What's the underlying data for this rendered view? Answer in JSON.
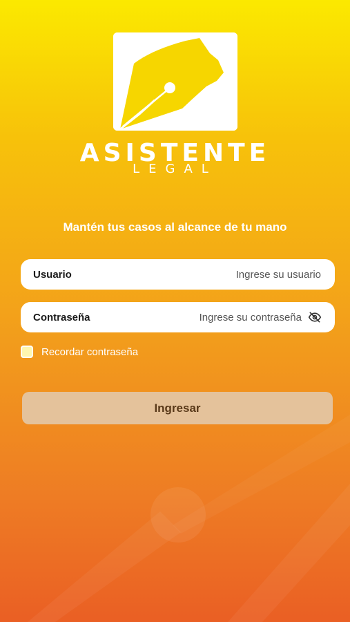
{
  "brand": {
    "title": "ASISTENTE",
    "subtitle": "LEGAL",
    "logo_icon": "pen-nib-icon"
  },
  "tagline": "Mantén tus casos al alcance de tu mano",
  "form": {
    "username": {
      "label": "Usuario",
      "placeholder": "Ingrese su usuario",
      "value": ""
    },
    "password": {
      "label": "Contraseña",
      "placeholder": "Ingrese su contraseña",
      "value": "",
      "toggle_icon": "eye-off-icon"
    },
    "remember": {
      "label": "Recordar contraseña",
      "checked": false
    },
    "submit_label": "Ingresar"
  },
  "colors": {
    "gradient_top": "#fbe900",
    "gradient_bottom": "#ea5f24",
    "button_bg": "#e2c8a8",
    "button_text": "#5a3a1a"
  }
}
